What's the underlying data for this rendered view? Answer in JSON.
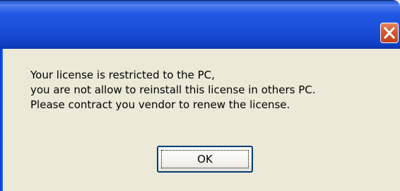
{
  "window": {
    "title": "",
    "close_icon": "close-x-icon"
  },
  "message": {
    "lines": [
      "Your license is restricted to the PC,",
      "you are not allow to reinstall this license in others PC.",
      "Please contract you vendor to renew the license."
    ]
  },
  "buttons": {
    "ok_label": "OK"
  },
  "colors": {
    "titlebar": "#2d62e6",
    "close_button": "#d9582d",
    "dialog_background": "#ece9d8"
  }
}
